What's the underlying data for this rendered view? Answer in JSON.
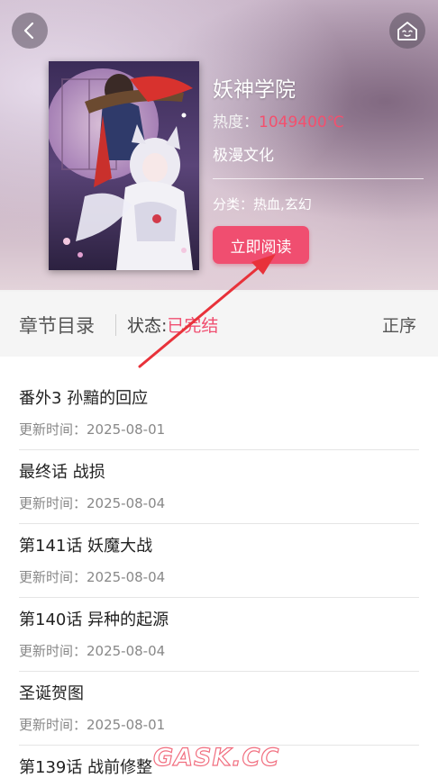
{
  "header": {
    "title": "妖神学院",
    "heat_label": "热度：",
    "heat_value": "1049400℃",
    "publisher": "极漫文化",
    "genre": "分类：热血,玄幻",
    "read_button": "立即阅读",
    "back_icon": "chevron-left-icon",
    "home_icon": "home-face-icon"
  },
  "toc": {
    "title": "章节目录",
    "status_label": "状态:",
    "status_value": "已完结",
    "sort_label": "正序"
  },
  "chapters": [
    {
      "name": "番外3 孙黯的回应",
      "date": "更新时间：2025-08-01"
    },
    {
      "name": "最终话 战损",
      "date": "更新时间：2025-08-04"
    },
    {
      "name": "第141话 妖魔大战",
      "date": "更新时间：2025-08-04"
    },
    {
      "name": "第140话 异种的起源",
      "date": "更新时间：2025-08-04"
    },
    {
      "name": "圣诞贺图",
      "date": "更新时间：2025-08-01"
    },
    {
      "name": "第139话 战前修整",
      "date": ""
    }
  ],
  "watermark": "GASK.CC",
  "colors": {
    "accent": "#f04e70",
    "arrow": "#e8323a"
  }
}
